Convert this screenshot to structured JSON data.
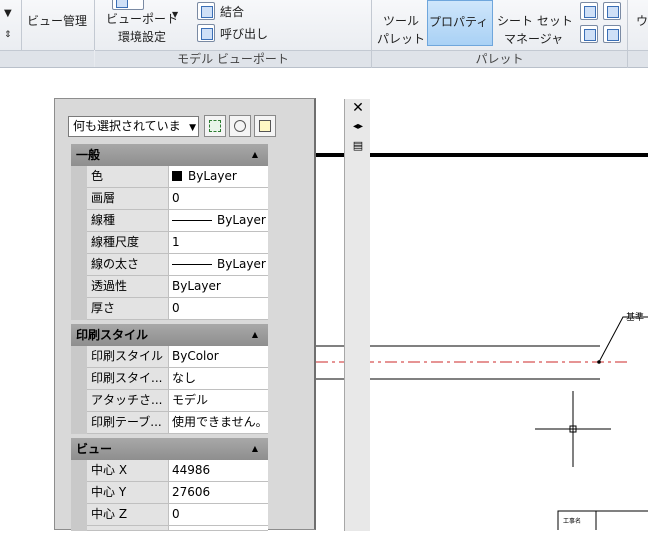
{
  "ribbon": {
    "view_manager": "ビュー管理",
    "viewport": "ビューポート",
    "viewport_config": "環境設定",
    "join": "結合",
    "restore": "呼び出し",
    "group_model_viewport": "モデル ビューポート",
    "tool_palettes_l1": "ツール",
    "tool_palettes_l2": "パレット",
    "properties": "プロパティ",
    "sheet_set_l1": "シート セット",
    "sheet_set_l2": "マネージャ",
    "group_palettes": "パレット",
    "cut_char": "ウ"
  },
  "palette": {
    "selection": "何も選択されていま",
    "sections": [
      {
        "title": "一般",
        "rows": [
          {
            "name": "色",
            "value": "ByLayer",
            "type": "color"
          },
          {
            "name": "画層",
            "value": "0",
            "type": "text"
          },
          {
            "name": "線種",
            "value": "ByLayer",
            "type": "line"
          },
          {
            "name": "線種尺度",
            "value": "1",
            "type": "text"
          },
          {
            "name": "線の太さ",
            "value": "ByLayer",
            "type": "line"
          },
          {
            "name": "透過性",
            "value": "ByLayer",
            "type": "text"
          },
          {
            "name": "厚さ",
            "value": "0",
            "type": "text"
          }
        ]
      },
      {
        "title": "印刷スタイル",
        "rows": [
          {
            "name": "印刷スタイル",
            "value": "ByColor",
            "type": "text"
          },
          {
            "name": "印刷スタイ...",
            "value": "なし",
            "type": "text"
          },
          {
            "name": "アタッチさ...",
            "value": "モデル",
            "type": "text"
          },
          {
            "name": "印刷テーブ...",
            "value": "使用できません。",
            "type": "text"
          }
        ]
      },
      {
        "title": "ビュー",
        "rows": [
          {
            "name": "中心 X",
            "value": "44986",
            "type": "text"
          },
          {
            "name": "中心 Y",
            "value": "27606",
            "type": "text"
          },
          {
            "name": "中心 Z",
            "value": "0",
            "type": "text"
          }
        ]
      }
    ]
  },
  "drawing": {
    "leader_label": "基準",
    "title_block_label": "工事名"
  },
  "colors": {
    "center_line": "#cc2a2a",
    "ribbon_active": "#a9d1f5"
  }
}
